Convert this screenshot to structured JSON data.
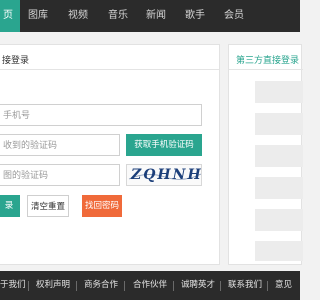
{
  "topnav": {
    "items": [
      {
        "label": "页",
        "active": true
      },
      {
        "label": "图库"
      },
      {
        "label": "视频"
      },
      {
        "label": "音乐"
      },
      {
        "label": "新闻"
      },
      {
        "label": "歌手"
      },
      {
        "label": "会员"
      }
    ]
  },
  "login": {
    "title": "接登录",
    "phone_placeholder": "手机号",
    "sms_placeholder": "收到的验证码",
    "get_sms_button": "获取手机验证码",
    "captcha_placeholder": "图的验证码",
    "captcha_text": "ZQHNH",
    "submit_button": "录",
    "reset_button": "清空重置",
    "recover_button": "找回密码"
  },
  "third_party": {
    "title": "第三方直接登录"
  },
  "footer": {
    "links": [
      "于我们",
      "权利声明",
      "商务合作",
      "合作伙伴",
      "诚聘英才",
      "联系我们",
      "意见"
    ]
  },
  "colors": {
    "accent": "#2aa58f",
    "orange": "#f06a3a",
    "dark_bar": "#2b2b2b"
  }
}
